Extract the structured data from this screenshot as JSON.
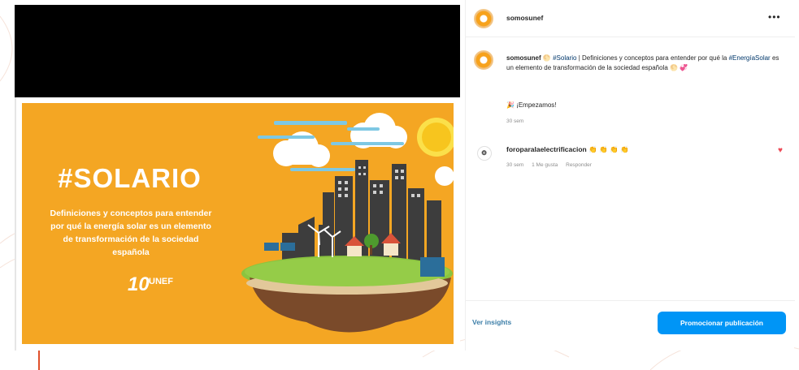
{
  "post": {
    "username": "somosunef",
    "more_label": "•••",
    "caption_user": "somosunef",
    "caption_icon": "🌕",
    "caption_hashtag1": "#Solario",
    "caption_text1": "| Definiciones y conceptos para entender por qué la",
    "caption_hashtag2": "#EnergíaSolar",
    "caption_text2": "es un elemento de transformación de la sociedad española",
    "caption_end_icons": "🌕 💞",
    "empezamos": "🎉 ¡Empezamos!",
    "time": "30 sem"
  },
  "comment": {
    "username": "foroparalaelectrificacion",
    "emojis": "👏 👏 👏 👏",
    "time": "30 sem",
    "likes": "1 Me gusta",
    "reply": "Responder",
    "heart": "♥"
  },
  "footer": {
    "insights": "Ver insights",
    "promote": "Promocionar publicación"
  },
  "media": {
    "title": "#SOLARIO",
    "subtitle": "Definiciones y conceptos para entender por qué la energía solar es un elemento de transformación de la sociedad española",
    "logo_number": "10",
    "logo_text": "UNEF",
    "card_color": "#f4a623"
  },
  "colors": {
    "accent": "#0095f6",
    "link": "#00376b",
    "heart": "#ed4956"
  }
}
